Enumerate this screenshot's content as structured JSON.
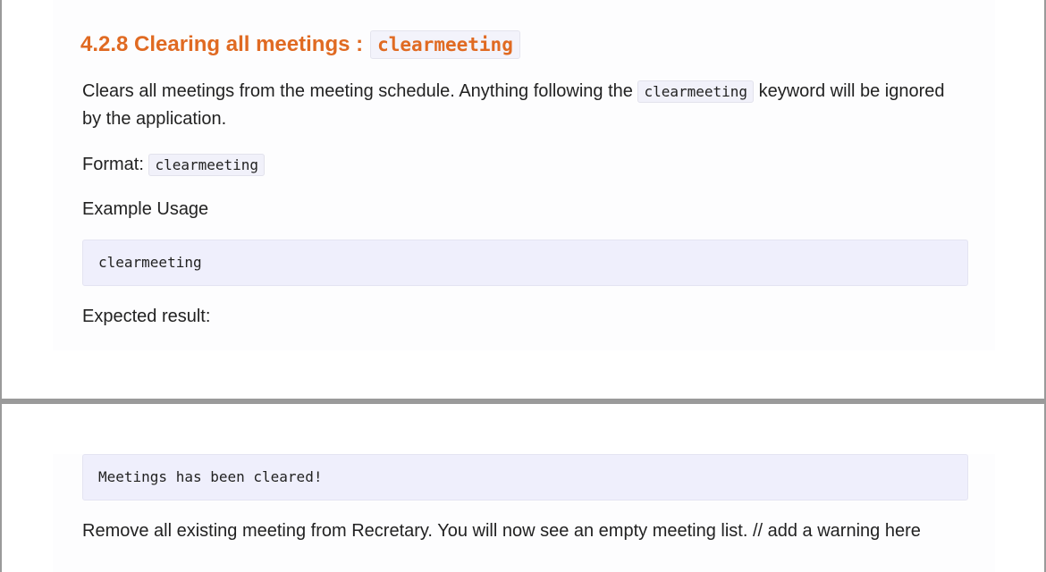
{
  "section": {
    "number_title": "4.2.8 Clearing all meetings :",
    "command": "clearmeeting"
  },
  "description": {
    "before": "Clears all meetings from the meeting schedule. Anything following the",
    "code": "clearmeeting",
    "after": "keyword will be ignored by the application."
  },
  "format": {
    "label": "Format:",
    "code": "clearmeeting"
  },
  "example_usage": {
    "label": "Example Usage",
    "code": "clearmeeting"
  },
  "expected_result": {
    "label": "Expected result:",
    "output": "Meetings has been cleared!",
    "note": "Remove all existing meeting from Recretary. You will now see an empty meeting list. // add a warning here"
  }
}
